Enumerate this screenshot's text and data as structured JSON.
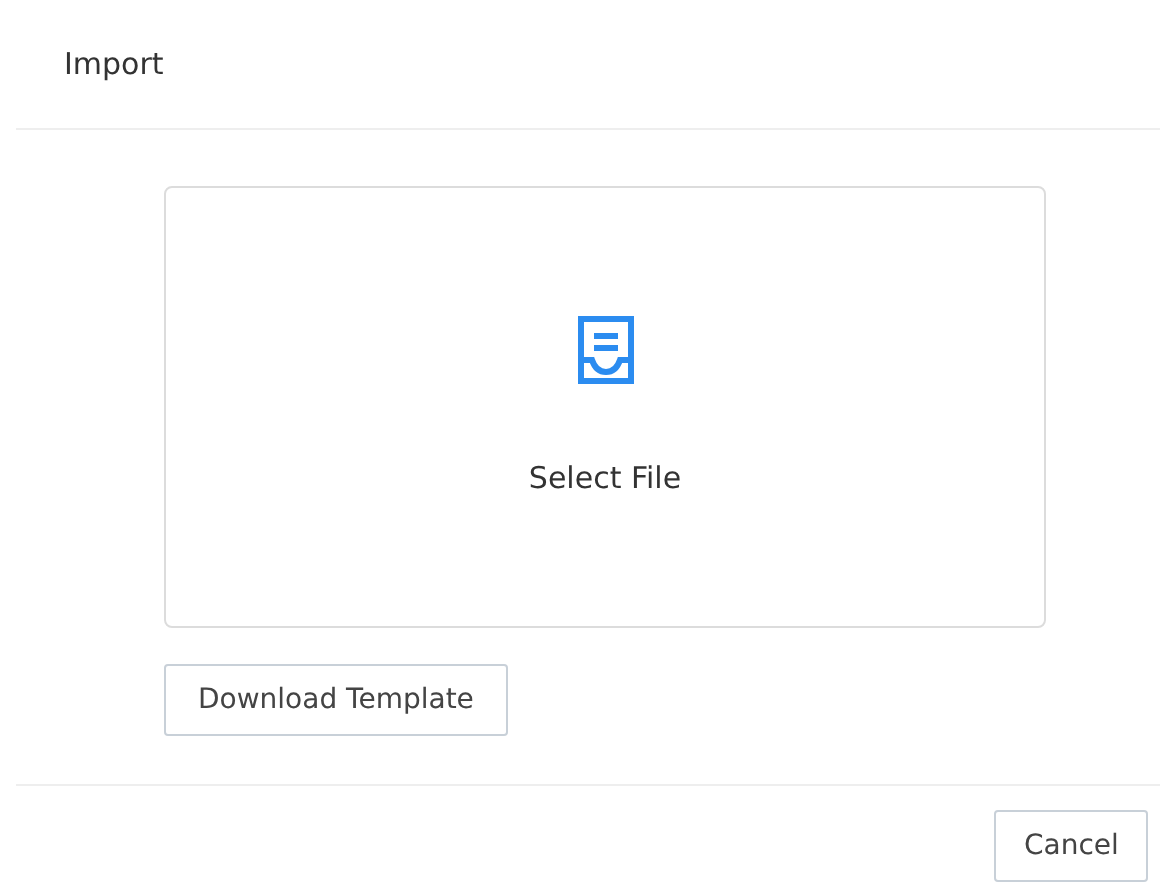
{
  "dialog": {
    "title": "Import",
    "upload_area": {
      "label": "Select File"
    },
    "template_button": "Download Template",
    "footer_buttons": [
      "Cancel"
    ]
  }
}
